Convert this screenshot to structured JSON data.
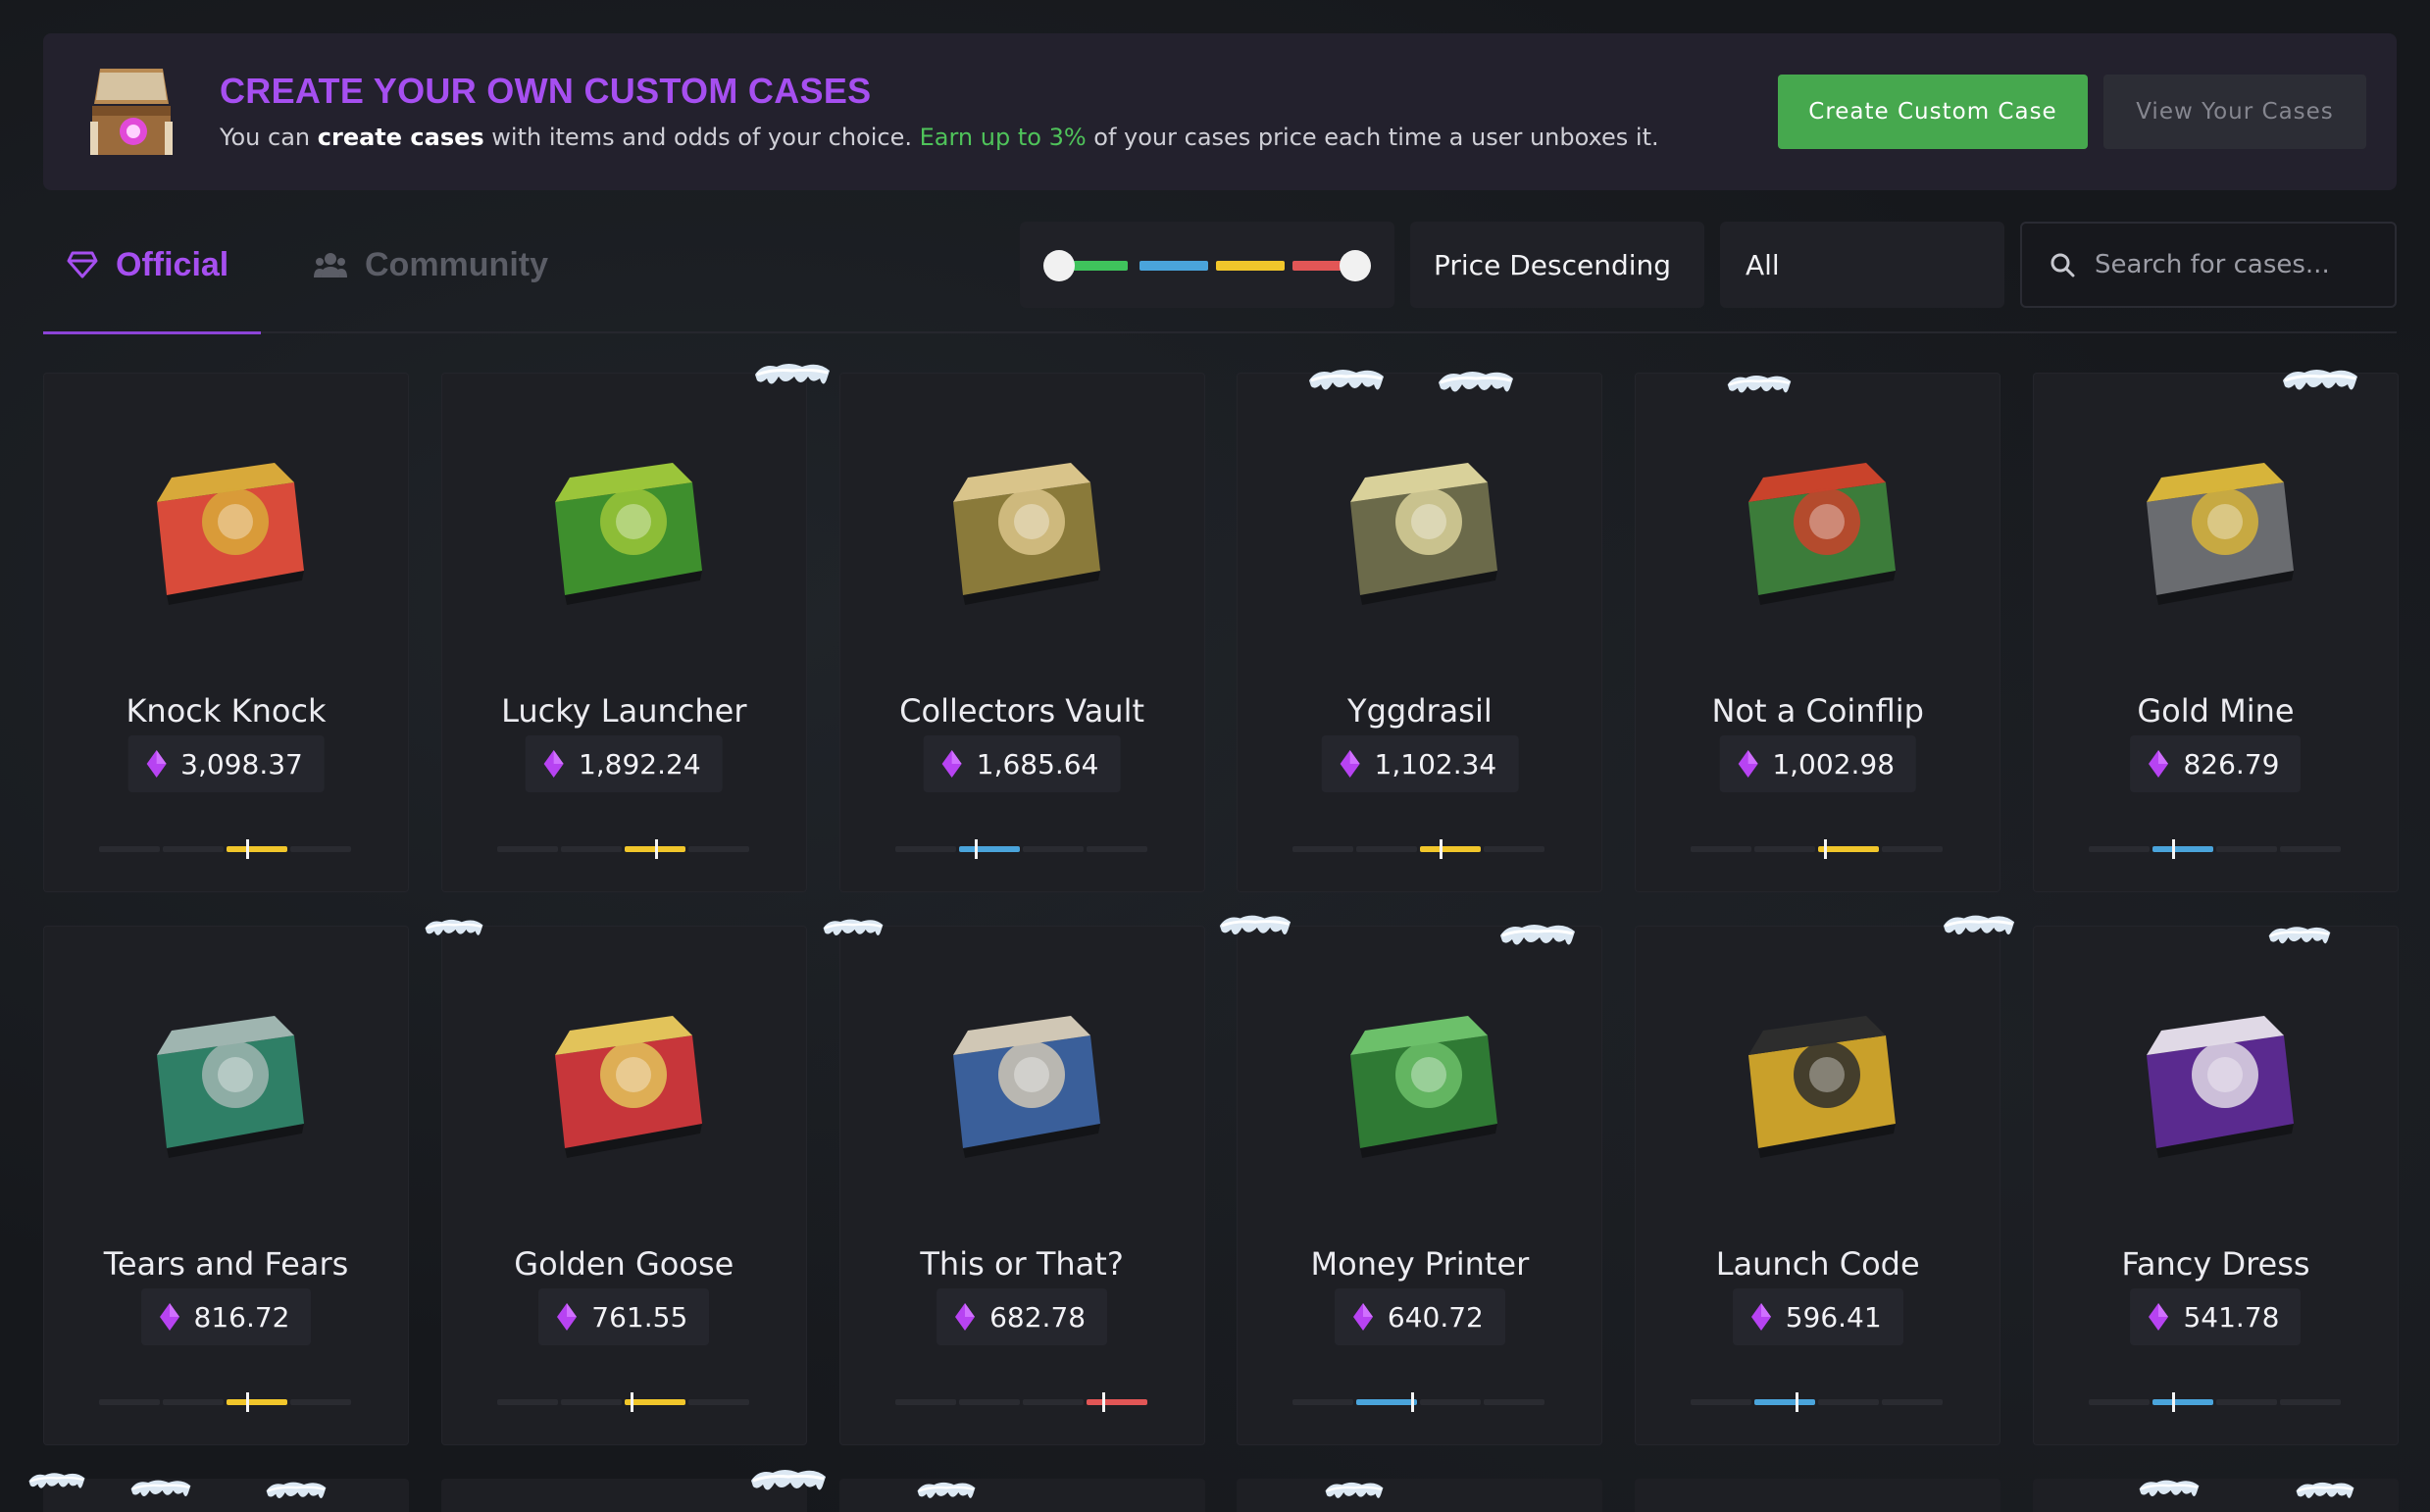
{
  "banner": {
    "title": "CREATE YOUR OWN CUSTOM CASES",
    "desc_1": "You can ",
    "desc_bold": "create cases",
    "desc_2": " with items and odds of your choice. ",
    "desc_green": "Earn up to 3%",
    "desc_3": " of your cases price each time a user unboxes it.",
    "create_button": "Create Custom Case",
    "view_button": "View Your Cases",
    "chest_icon": "treasure-chest-icon"
  },
  "tabs": [
    {
      "label": "Official",
      "icon": "diamond-outline-icon",
      "active": true
    },
    {
      "label": "Community",
      "icon": "users-icon",
      "active": false
    }
  ],
  "filters": {
    "risk_range_colors": [
      "#3fc35c",
      "#4aa4db",
      "#f1c62b",
      "#e25656"
    ],
    "sort": "Price Descending",
    "category": "All",
    "search_placeholder": "Search for cases..."
  },
  "colors": {
    "accent": "#a64ff0",
    "green": "#46a84e",
    "risk_low": "#3fc35c",
    "risk_medium": "#4aa4db",
    "risk_high": "#f1c62b",
    "risk_extreme": "#e25656",
    "gem": "#b743f2"
  },
  "cases": [
    {
      "name": "Knock Knock",
      "price": "3,098.37",
      "risk_level": 3,
      "risk_color": "#f1c62b",
      "marker_segment_pos": 0.33,
      "theme": [
        "#d94b3a",
        "#d8a93a"
      ]
    },
    {
      "name": "Lucky Launcher",
      "price": "1,892.24",
      "risk_level": 3,
      "risk_color": "#f1c62b",
      "marker_segment_pos": 0.5,
      "theme": [
        "#3e8f2d",
        "#9bc53a"
      ]
    },
    {
      "name": "Collectors Vault",
      "price": "1,685.64",
      "risk_level": 2,
      "risk_color": "#4aa4db",
      "marker_segment_pos": 0.25,
      "theme": [
        "#8a7a3a",
        "#d9c48a"
      ]
    },
    {
      "name": "Yggdrasil",
      "price": "1,102.34",
      "risk_level": 3,
      "risk_color": "#f1c62b",
      "marker_segment_pos": 0.33,
      "theme": [
        "#6b6a4a",
        "#d9d19a"
      ]
    },
    {
      "name": "Not a Coinflip",
      "price": "1,002.98",
      "risk_level": 3,
      "risk_color": "#f1c62b",
      "marker_segment_pos": 0.1,
      "theme": [
        "#3c7c3a",
        "#c9432b"
      ]
    },
    {
      "name": "Gold Mine",
      "price": "826.79",
      "risk_level": 2,
      "risk_color": "#4aa4db",
      "marker_segment_pos": 0.33,
      "theme": [
        "#6a6c70",
        "#d7b43a"
      ]
    },
    {
      "name": "Tears and Fears",
      "price": "816.72",
      "risk_level": 3,
      "risk_color": "#f1c62b",
      "marker_segment_pos": 0.33,
      "theme": [
        "#2f7f66",
        "#9fb5b0"
      ]
    },
    {
      "name": "Golden Goose",
      "price": "761.55",
      "risk_level": 3,
      "risk_color": "#f1c62b",
      "marker_segment_pos": 0.1,
      "theme": [
        "#c7363a",
        "#e2c35a"
      ]
    },
    {
      "name": "This or That?",
      "price": "682.78",
      "risk_level": 4,
      "risk_color": "#e25656",
      "marker_segment_pos": 0.25,
      "theme": [
        "#3a5f9a",
        "#d0c7b5"
      ]
    },
    {
      "name": "Money Printer",
      "price": "640.72",
      "risk_level": 2,
      "risk_color": "#4aa4db",
      "marker_segment_pos": 0.9,
      "theme": [
        "#2f7a34",
        "#6cc06a"
      ]
    },
    {
      "name": "Launch Code",
      "price": "596.41",
      "risk_level": 2,
      "risk_color": "#4aa4db",
      "marker_segment_pos": 0.67,
      "theme": [
        "#c9a02a",
        "#2d2d2d"
      ]
    },
    {
      "name": "Fancy Dress",
      "price": "541.78",
      "risk_level": 2,
      "risk_color": "#4aa4db",
      "marker_segment_pos": 0.33,
      "theme": [
        "#5a2a8f",
        "#e0d9e6"
      ]
    }
  ]
}
